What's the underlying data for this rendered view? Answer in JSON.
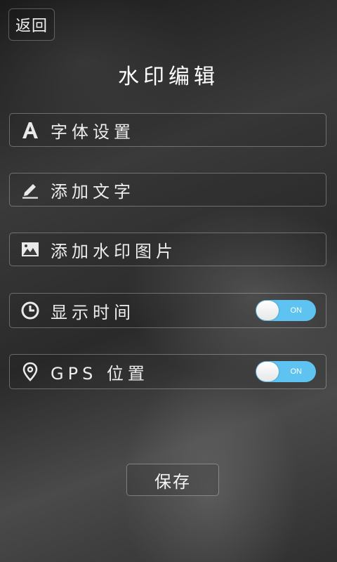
{
  "header": {
    "back_label": "返回",
    "title": "水印编辑"
  },
  "menu": {
    "items": [
      {
        "label": "字体设置",
        "icon": "font-icon"
      },
      {
        "label": "添加文字",
        "icon": "pen-icon"
      },
      {
        "label": "添加水印图片",
        "icon": "image-icon"
      },
      {
        "label": "显示时间",
        "icon": "clock-icon",
        "toggle": {
          "state": "ON"
        }
      },
      {
        "label": "GPS 位置",
        "icon": "location-pin-icon",
        "toggle": {
          "state": "ON"
        }
      }
    ]
  },
  "footer": {
    "save_label": "保存"
  },
  "colors": {
    "toggle_on": "#5ec3f0",
    "border": "rgba(255,255,255,0.30)"
  }
}
